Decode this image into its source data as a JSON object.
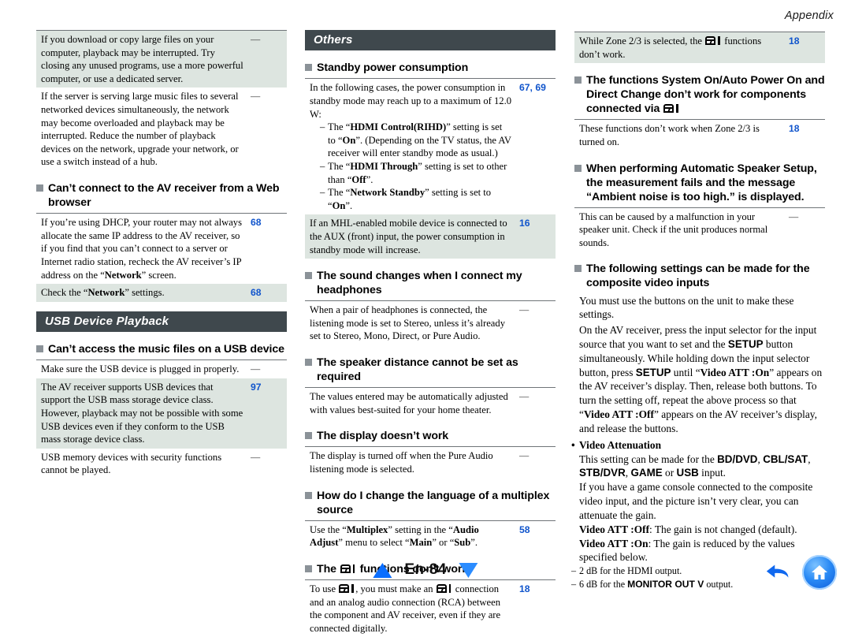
{
  "running_head": "Appendix",
  "page_label": "En-84",
  "colors": {
    "section_bar": "#3f484d",
    "shaded_row": "#dde5e0",
    "page_ref": "#1155cc",
    "bullet_square": "#8b9298",
    "nav_blue": "#0a6eff"
  },
  "column1": {
    "carryover_rows": [
      {
        "shaded": true,
        "text": "If you download or copy large files on your computer, playback may be interrupted. Try closing any unused programs, use a more powerful computer, or use a dedicated server.",
        "ref": "—"
      },
      {
        "shaded": false,
        "text": "If the server is serving large music files to several networked devices simultaneously, the network may become overloaded and playback may be interrupted. Reduce the number of playback devices on the network, upgrade your network, or use a switch instead of a hub.",
        "ref": "—"
      }
    ],
    "q_web_browser": {
      "heading": "Can’t connect to the AV receiver from a Web browser",
      "rows": [
        {
          "shaded": false,
          "ref": "68",
          "segments": [
            {
              "t": "If you’re using DHCP, your router may not always allocate the same IP address to the AV receiver, so if you find that you can’t connect to a server or Internet radio station, recheck the AV receiver’s IP address on the “",
              "b": false
            },
            {
              "t": "Network",
              "b": true
            },
            {
              "t": "” screen.",
              "b": false
            }
          ]
        },
        {
          "shaded": true,
          "ref": "68",
          "segments": [
            {
              "t": "Check the “",
              "b": false
            },
            {
              "t": "Network",
              "b": true
            },
            {
              "t": "” settings.",
              "b": false
            }
          ]
        }
      ]
    },
    "section_usb": "USB Device Playback",
    "q_usb_files": {
      "heading": "Can’t access the music files on a USB device",
      "rows": [
        {
          "shaded": false,
          "ref": "—",
          "text": "Make sure the USB device is plugged in properly."
        },
        {
          "shaded": true,
          "ref": "97",
          "text": "The AV receiver supports USB devices that support the USB mass storage device class. However, playback may not be possible with some USB devices even if they conform to the USB mass storage device class."
        },
        {
          "shaded": false,
          "ref": "—",
          "text": "USB memory devices with security functions cannot be played."
        }
      ]
    }
  },
  "column2": {
    "section_others": "Others",
    "q_standby": {
      "heading": "Standby power consumption",
      "row_main": {
        "ref": "67, 69",
        "intro": "In the following cases, the power consumption in standby mode may reach up to a maximum of 12.0 W:",
        "bullets": [
          [
            {
              "t": "The “",
              "b": false
            },
            {
              "t": "HDMI Control(RIHD)",
              "b": true
            },
            {
              "t": "” setting is set to “",
              "b": false
            },
            {
              "t": "On",
              "b": true
            },
            {
              "t": "”. (Depending on the TV status, the AV receiver will enter standby mode as usual.)",
              "b": false
            }
          ],
          [
            {
              "t": "The “",
              "b": false
            },
            {
              "t": "HDMI Through",
              "b": true
            },
            {
              "t": "” setting is set to other than “",
              "b": false
            },
            {
              "t": "Off",
              "b": true
            },
            {
              "t": "”.",
              "b": false
            }
          ],
          [
            {
              "t": "The “",
              "b": false
            },
            {
              "t": "Network Standby",
              "b": true
            },
            {
              "t": "” setting is set to “",
              "b": false
            },
            {
              "t": "On",
              "b": true
            },
            {
              "t": "”.",
              "b": false
            }
          ]
        ]
      },
      "row_mhl": {
        "shaded": true,
        "ref": "16",
        "text": "If an MHL-enabled mobile device is connected to the AUX (front) input, the power consumption in standby mode will increase."
      }
    },
    "q_headphones": {
      "heading": "The sound changes when I connect my headphones",
      "rows": [
        {
          "shaded": false,
          "ref": "—",
          "text": "When a pair of headphones is connected, the listening mode is set to Stereo, unless it’s already set to Stereo, Mono, Direct, or Pure Audio."
        }
      ]
    },
    "q_speaker_distance": {
      "heading": "The speaker distance cannot be set as required",
      "rows": [
        {
          "shaded": false,
          "ref": "—",
          "text": "The values entered may be automatically adjusted with values best-suited for your home theater."
        }
      ]
    },
    "q_display": {
      "heading": "The display doesn’t work",
      "rows": [
        {
          "shaded": false,
          "ref": "—",
          "text": "The display is turned off when the Pure Audio listening mode is selected."
        }
      ]
    },
    "q_multiplex": {
      "heading": "How do I change the language of a multiplex source",
      "rows": [
        {
          "shaded": false,
          "ref": "58",
          "segments": [
            {
              "t": "Use the “",
              "b": false
            },
            {
              "t": "Multiplex",
              "b": true
            },
            {
              "t": "” setting in the “",
              "b": false
            },
            {
              "t": "Audio Adjust",
              "b": true
            },
            {
              "t": "” menu to select “",
              "b": false
            },
            {
              "t": "Main",
              "b": true
            },
            {
              "t": "” or “",
              "b": false
            },
            {
              "t": "Sub",
              "b": true
            },
            {
              "t": "”.",
              "b": false
            }
          ]
        }
      ]
    },
    "q_ri": {
      "heading_before": "The ",
      "heading_after": " functions don’t work",
      "row": {
        "ref": "18",
        "p1": "To use ",
        "p2": ", you must make an ",
        "p3": " connection and an analog audio connection (RCA) between the component and AV receiver, even if they are connected digitally."
      }
    }
  },
  "column3": {
    "row_zone": {
      "shaded": true,
      "ref": "18",
      "p1": "While Zone 2/3 is selected, the ",
      "p2": " functions don’t work."
    },
    "q_system_on": {
      "heading_p1": "The functions System On/Auto Power On and Direct Change don’t work for components connected via ",
      "rows": [
        {
          "shaded": false,
          "ref": "18",
          "text": "These functions don’t work when Zone 2/3 is turned on."
        }
      ]
    },
    "q_auto_setup": {
      "heading": "When performing Automatic Speaker Setup, the measurement fails and the message “Ambient noise is too high.” is displayed.",
      "rows": [
        {
          "shaded": false,
          "ref": "—",
          "text": "This can be caused by a malfunction in your speaker unit. Check if the unit produces normal sounds."
        }
      ]
    },
    "q_composite": {
      "heading": "The following settings can be made for the composite video inputs",
      "paragraphs": [
        [
          {
            "t": "You must use the buttons on the unit to make these settings.",
            "b": false,
            "sans": false
          }
        ],
        [
          {
            "t": "On the AV receiver, press the input selector for the input source that you want to set and the ",
            "b": false,
            "sans": false
          },
          {
            "t": "SETUP",
            "b": true,
            "sans": true
          },
          {
            "t": " button simultaneously. While holding down the input selector button, press ",
            "b": false,
            "sans": false
          },
          {
            "t": "SETUP",
            "b": true,
            "sans": true
          },
          {
            "t": " until “",
            "b": false,
            "sans": false
          },
          {
            "t": "Video ATT :On",
            "b": true,
            "sans": false
          },
          {
            "t": "” appears on the AV receiver’s display. Then, release both buttons. To turn the setting off, repeat the above process so that “",
            "b": false,
            "sans": false
          },
          {
            "t": "Video ATT :Off",
            "b": true,
            "sans": false
          },
          {
            "t": "” appears on the AV receiver’s display, and release the buttons.",
            "b": false,
            "sans": false
          }
        ]
      ],
      "sub_bullet": "Video Attenuation",
      "sub_paragraphs": [
        [
          {
            "t": "This setting can be made for the ",
            "b": false,
            "sans": false
          },
          {
            "t": "BD/DVD",
            "b": true,
            "sans": true
          },
          {
            "t": ", ",
            "b": false,
            "sans": false
          },
          {
            "t": "CBL/SAT",
            "b": true,
            "sans": true
          },
          {
            "t": ", ",
            "b": false,
            "sans": false
          },
          {
            "t": "STB/DVR",
            "b": true,
            "sans": true
          },
          {
            "t": ", ",
            "b": false,
            "sans": false
          },
          {
            "t": "GAME",
            "b": true,
            "sans": true
          },
          {
            "t": " or ",
            "b": false,
            "sans": false
          },
          {
            "t": "USB",
            "b": true,
            "sans": true
          },
          {
            "t": " input.",
            "b": false,
            "sans": false
          }
        ],
        [
          {
            "t": "If you have a game console connected to the composite video input, and the picture isn’t very clear, you can attenuate the gain.",
            "b": false,
            "sans": false
          }
        ],
        [
          {
            "t": "Video ATT :Off",
            "b": true,
            "sans": false
          },
          {
            "t": ": The gain is not changed (default).",
            "b": false,
            "sans": false
          }
        ],
        [
          {
            "t": "Video ATT :On",
            "b": true,
            "sans": false
          },
          {
            "t": ": The gain is reduced by the values specified below.",
            "b": false,
            "sans": false
          }
        ]
      ],
      "dash_lines": [
        [
          {
            "t": "2 dB for the HDMI output.",
            "b": false,
            "sans": false
          }
        ],
        [
          {
            "t": "6 dB for the ",
            "b": false,
            "sans": false
          },
          {
            "t": "MONITOR OUT V",
            "b": true,
            "sans": true
          },
          {
            "t": " output.",
            "b": false,
            "sans": false
          }
        ]
      ]
    }
  },
  "footer": {
    "prev_label": "previous-page",
    "next_label": "next-page",
    "back_label": "back",
    "home_label": "home"
  }
}
